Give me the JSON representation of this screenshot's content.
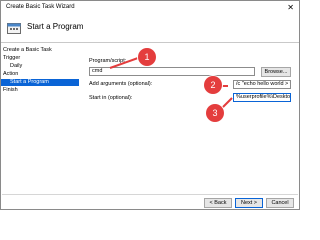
{
  "window": {
    "title": "Create Basic Task Wizard",
    "close_glyph": "✕"
  },
  "header": {
    "title": "Start a Program",
    "icon": "task-scheduler-icon"
  },
  "nav": {
    "items": [
      {
        "label": "Create a Basic Task"
      },
      {
        "label": "Trigger"
      },
      {
        "label": "Daily"
      },
      {
        "label": "Action"
      },
      {
        "label": "Start a Program",
        "selected": true
      },
      {
        "label": "Finish"
      }
    ]
  },
  "form": {
    "program_label": "Program/script:",
    "program_value": "cmd",
    "browse_label": "Browse...",
    "args_label": "Add arguments (optional):",
    "args_value": "/c \"echo hello world > te",
    "startin_label": "Start in (optional):",
    "startin_value": "%userprofile%\\Desktop"
  },
  "footer": {
    "back_label": "< Back",
    "next_label": "Next >",
    "cancel_label": "Cancel"
  },
  "callouts": {
    "one": "1",
    "two": "2",
    "three": "3",
    "color": "#e43d3d"
  },
  "colors": {
    "accent": "#0a64d6"
  }
}
